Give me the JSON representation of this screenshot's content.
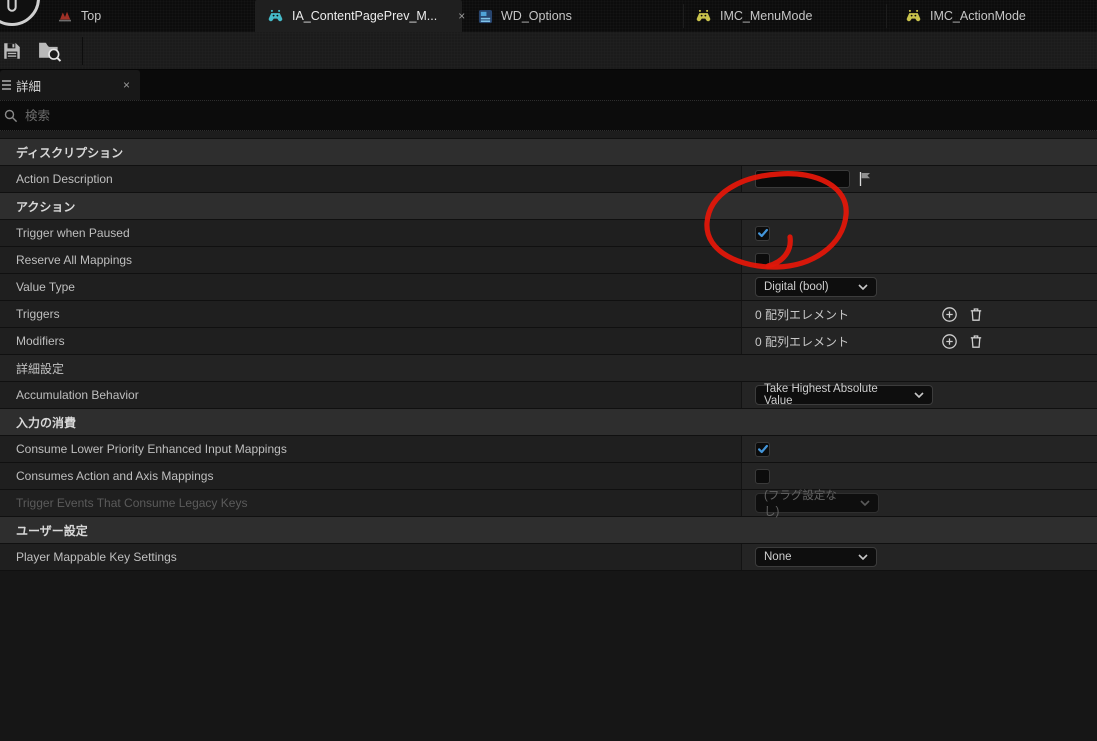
{
  "tab_bar": {
    "tabs": [
      {
        "label": "Top",
        "icon": "level-flame-icon",
        "active": false
      },
      {
        "label": "IA_ContentPagePrev_M...",
        "icon": "input-action-gamepad-icon",
        "active": true,
        "close_glyph": "×"
      },
      {
        "label": "WD_Options",
        "icon": "widget-blueprint-icon",
        "active": false
      },
      {
        "label": "IMC_MenuMode",
        "icon": "input-mapping-context-icon",
        "active": false
      },
      {
        "label": "IMC_ActionMode",
        "icon": "input-mapping-context-icon",
        "active": false
      }
    ]
  },
  "toolbar": {
    "save_icon": "floppy-save-icon",
    "browse_icon": "browse-to-asset-icon"
  },
  "details_panel": {
    "tab_label": "詳細",
    "tab_icon": "details-list-icon",
    "close_glyph": "×",
    "search_placeholder": "検索",
    "search_icon": "search-icon"
  },
  "rows": {
    "section_description": {
      "title": "ディスクリプション"
    },
    "action_description": {
      "label": "Action Description",
      "value": "",
      "flag_icon": "localization-flag-icon"
    },
    "section_action": {
      "title": "アクション"
    },
    "trigger_when_paused": {
      "label": "Trigger when Paused",
      "checked": true
    },
    "reserve_all_mappings": {
      "label": "Reserve All Mappings",
      "checked": false
    },
    "value_type": {
      "label": "Value Type",
      "value": "Digital (bool)"
    },
    "triggers": {
      "label": "Triggers",
      "value": "0 配列エレメント",
      "add_icon": "add-element-icon",
      "clear_icon": "clear-array-trash-icon"
    },
    "modifiers": {
      "label": "Modifiers",
      "value": "0 配列エレメント",
      "add_icon": "add-element-icon",
      "clear_icon": "clear-array-trash-icon"
    },
    "advanced": {
      "title": "詳細設定"
    },
    "accumulation_behavior": {
      "label": "Accumulation Behavior",
      "value": "Take Highest Absolute Value"
    },
    "section_input_consumption": {
      "title": "入力の消費"
    },
    "consume_lower_priority": {
      "label": "Consume Lower Priority Enhanced Input Mappings",
      "checked": true
    },
    "consumes_action_axis": {
      "label": "Consumes Action and Axis Mappings",
      "checked": false
    },
    "trigger_events_legacy": {
      "label": "Trigger Events That Consume Legacy Keys",
      "value": "(フラグ設定なし)",
      "disabled": true
    },
    "section_user_settings": {
      "title": "ユーザー設定"
    },
    "player_mappable": {
      "label": "Player Mappable Key Settings",
      "value": "None"
    }
  },
  "annotation": {
    "shape": "hand-drawn-red-circle",
    "color": "#e2170a",
    "target": "Trigger when Paused checkbox"
  },
  "colors": {
    "check_blue": "#4395d9",
    "tab_icon_teal": "#45bbc9",
    "tab_icon_yellow": "#c9c34c",
    "tab_icon_red": "#a03026"
  }
}
